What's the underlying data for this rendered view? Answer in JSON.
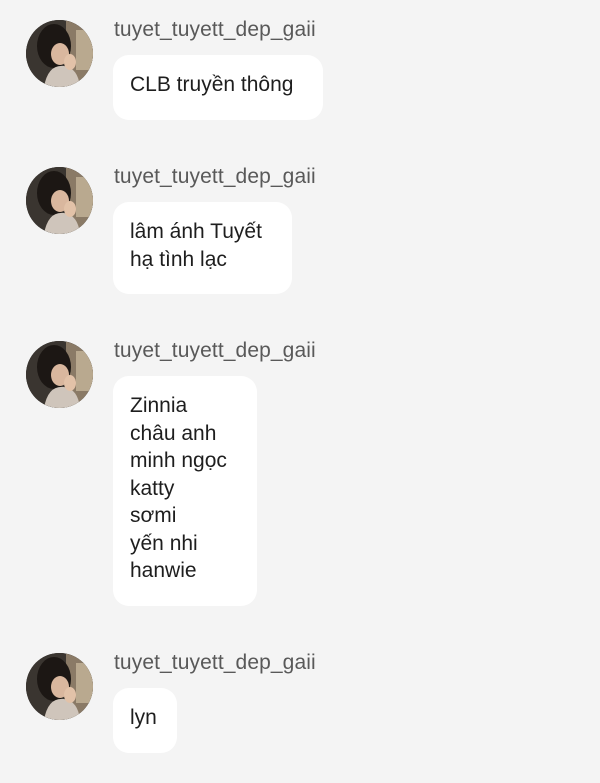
{
  "messages": [
    {
      "username": "tuyet_tuyett_dep_gaii",
      "lines": [
        "CLB truyền thông"
      ]
    },
    {
      "username": "tuyet_tuyett_dep_gaii",
      "lines": [
        "lâm ánh Tuyết",
        "hạ tình lạc"
      ]
    },
    {
      "username": "tuyet_tuyett_dep_gaii",
      "lines": [
        "Zinnia",
        "châu anh",
        "minh ngọc",
        "katty",
        "sơmi",
        "yến nhi",
        "hanwie"
      ]
    },
    {
      "username": "tuyet_tuyett_dep_gaii",
      "lines": [
        "lyn"
      ]
    }
  ],
  "icons": {
    "avatar": "profile-photo-icon"
  }
}
